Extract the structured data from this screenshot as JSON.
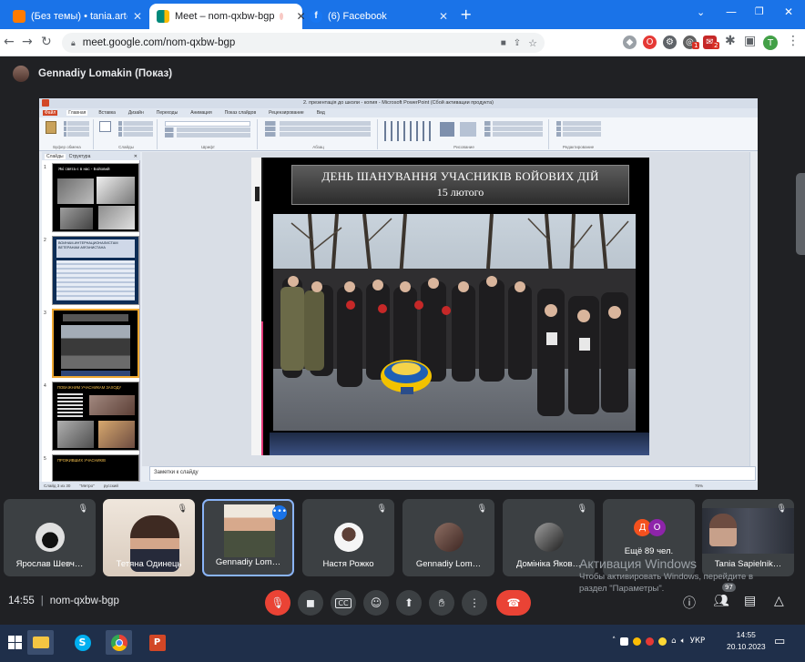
{
  "browser": {
    "tabs": [
      {
        "title": "(Без темы) • tania.art@ukr.net",
        "icon": "mail-icon",
        "color": "#ff7b00"
      },
      {
        "title": "Meet – nom-qxbw-bgp",
        "icon": "meet-icon",
        "color": "#00897b"
      },
      {
        "title": "(6) Facebook",
        "icon": "facebook-icon",
        "color": "#1877f2"
      }
    ],
    "new_tab": "+",
    "url": "meet.google.com/nom-qxbw-bgp",
    "profile_initial": "T",
    "ext_badge_1": "1",
    "ext_badge_2": "2"
  },
  "meet": {
    "presenter_label": "Gennadiy Lomakin (Показ)",
    "meeting_time": "14:55",
    "separator": "|",
    "meeting_code": "nom-qxbw-bgp",
    "people_count": "97",
    "participants": [
      {
        "name": "Ярослав Шевч…",
        "muted": true
      },
      {
        "name": "Тетяна Одинець",
        "muted": true
      },
      {
        "name": "Gennadiy Lom…",
        "muted": false,
        "speaking": true
      },
      {
        "name": "Настя Рожко",
        "muted": true
      },
      {
        "name": "Gennadiy Lom…",
        "muted": true
      },
      {
        "name": "Домініка Яков…",
        "muted": true
      },
      {
        "name": "Ещё 89 чел.",
        "muted": false,
        "avatars": [
          "Д",
          "О"
        ]
      },
      {
        "name": "Tania Sapielnik…",
        "muted": true
      }
    ],
    "windows_watermark": {
      "line1": "Активация Windows",
      "line2": "Чтобы активировать Windows, перейдите в",
      "line3": "раздел \"Параметры\"."
    }
  },
  "powerpoint": {
    "window_title": "2. презентація до школи - копия - Microsoft PowerPoint (Сбой активации продукта)",
    "tabs": [
      "Файл",
      "Главная",
      "Вставка",
      "Дизайн",
      "Переходы",
      "Анимация",
      "Показ слайдов",
      "Рецензирование",
      "Вид"
    ],
    "ribbon_groups": [
      "Буфер обмена",
      "Слайды",
      "Шрифт",
      "Абзац",
      "Рисование",
      "Редактирование"
    ],
    "pane_tabs": [
      "Слайды",
      "Структура"
    ],
    "thumb_numbers": [
      "1",
      "2",
      "3",
      "4",
      "5"
    ],
    "thumb_texts": [
      "Які свята є в нас - Бойовий",
      "ВОИНАМ-ИНТЕРНАЦИОНАЛИСТАМ ВЕТЕРАНАМ АФГАНИСТАНА",
      "",
      "ПОВАЖНИМ УЧАСНИКАМ ЗАХОДУ",
      "ПРОЖИВШИХ УЧАСНИКІВ"
    ],
    "slide_title_line1": "ДЕНЬ ШАНУВАННЯ УЧАСНИКІВ БОЙОВИХ ДІЙ",
    "slide_title_line2": "15 лютого",
    "notes_placeholder": "Заметки к слайду",
    "status_items": [
      "Слайд 3 из 30",
      "\"Метро\"",
      "русский"
    ],
    "zoom": "75%"
  },
  "taskbar": {
    "language": "УКР",
    "time": "14:55",
    "date": "20.10.2023"
  },
  "colors": {
    "chrome_blue": "#1a73e8",
    "meet_bg": "#202124",
    "hangup_red": "#ea4335",
    "active_speaker": "#8ab4f8"
  }
}
